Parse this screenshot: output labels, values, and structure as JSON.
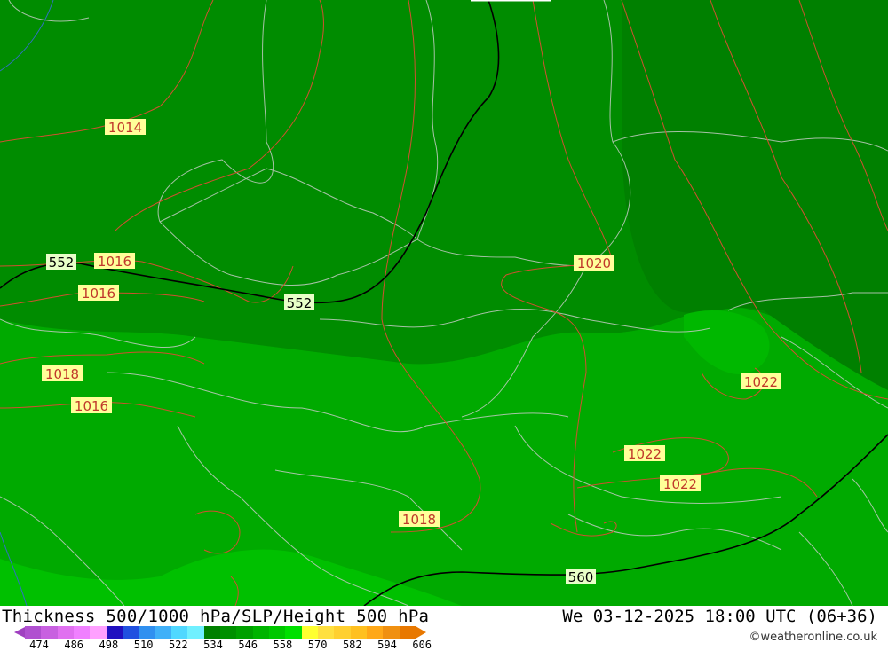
{
  "map": {
    "isobar_labels": [
      "1014",
      "1016",
      "1016",
      "1016",
      "1018",
      "1018",
      "1020",
      "1022",
      "1022",
      "1022"
    ],
    "height_labels": [
      "552",
      "552",
      "560"
    ]
  },
  "footer": {
    "title": "Thickness 500/1000 hPa/SLP/Height 500 hPa",
    "datetime": "We 03-12-2025 18:00 UTC (06+36)",
    "credit": "©weatheronline.co.uk"
  },
  "legend": {
    "ticks": [
      "474",
      "486",
      "498",
      "510",
      "522",
      "534",
      "546",
      "558",
      "570",
      "582",
      "594",
      "606"
    ],
    "colors": [
      "#b050d0",
      "#c860e0",
      "#e070f0",
      "#f080ff",
      "#ffa0ff",
      "#2010c0",
      "#2050e0",
      "#3090f0",
      "#40b0f8",
      "#50d8ff",
      "#70f0ff",
      "#008000",
      "#009000",
      "#00a000",
      "#00b400",
      "#00c800",
      "#00e000",
      "#ffff30",
      "#ffe040",
      "#ffd030",
      "#ffc020",
      "#ffa818",
      "#f09010",
      "#e87800"
    ],
    "brand_colors": {
      "dark_green": "#008a00",
      "mid_green": "#00a800",
      "light_green": "#00c000",
      "isobar": "#d05030",
      "height": "#000000"
    }
  }
}
